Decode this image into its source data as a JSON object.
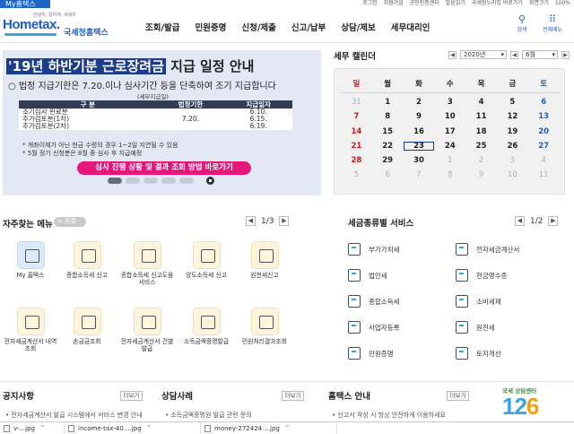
{
  "util": {
    "my_tab": "My홈택스",
    "links": [
      "로그인",
      "회원가입",
      "공인인증센터",
      "발음읽기",
      "국세청누리집 바로가기",
      "화면크기",
      "100%"
    ]
  },
  "header": {
    "logo_sub": "안녕히, 알차게, 세세히",
    "logo_home": "Hometax.",
    "logo_kor": "국세청홈택스",
    "nav": [
      "조회/발급",
      "민원증명",
      "신청/제출",
      "신고/납부",
      "상담/제보",
      "세무대리인"
    ],
    "search_label": "검색",
    "allmenu_label": "전체메뉴"
  },
  "banner": {
    "title_hl": "'19년 하반기분 근로장려금",
    "title_rest": " 지급 일정 안내",
    "line1": "○ 법정 지급기한은 7.20.이나 심사기간 등을 단축하여 조기 지급합니다",
    "note": "(세부지급일)",
    "table_headers": [
      "구   분",
      "법정기한",
      "지급일자"
    ],
    "table_rows": [
      [
        "조기심사 완료분",
        "",
        "6.10."
      ],
      [
        "추가검토분(1차)",
        "7.20.",
        "6.15."
      ],
      [
        "추가검토분(2차)",
        "",
        "6.19."
      ]
    ],
    "footnote1": "* 계좌이체가 아닌 현금 수령의 경우 1~2일 지연될 수 있음",
    "footnote2": "* 5월 정기 신청분은 8월 중 심사 후 지급예정",
    "cta": "심사 진행 상황 및 결과 조회 방법 바로가기"
  },
  "calendar": {
    "title": "세무 캘린더",
    "year": "2020년",
    "month": "6월",
    "weekdays": [
      "일",
      "월",
      "화",
      "수",
      "목",
      "금",
      "토"
    ],
    "weeks": [
      [
        "31",
        "1",
        "2",
        "3",
        "4",
        "5",
        "6"
      ],
      [
        "7",
        "8",
        "9",
        "10",
        "11",
        "12",
        "13"
      ],
      [
        "14",
        "15",
        "16",
        "17",
        "18",
        "19",
        "20"
      ],
      [
        "21",
        "22",
        "23",
        "24",
        "25",
        "26",
        "27"
      ],
      [
        "28",
        "29",
        "30",
        "1",
        "2",
        "3",
        "4"
      ],
      [
        "5",
        "6",
        "7",
        "8",
        "9",
        "10",
        "11"
      ]
    ],
    "today": "23"
  },
  "favorites": {
    "title": "자주찾는 메뉴",
    "add_label": "+ 등록",
    "page": "1/3",
    "items": [
      "My 홈택스",
      "종합소득세 신고",
      "종합소득세 신고도움 서비스",
      "양도소득세 신고",
      "원천세신고",
      "전자세금계산서 내역조회",
      "손금금조회",
      "전자세금계산서 건별발급",
      "소득금액증명발급",
      "민원처리결과조회"
    ]
  },
  "services": {
    "title": "세금종류별 서비스",
    "page": "1/2",
    "items": [
      "부가가치세",
      "전자세금계산서",
      "법인세",
      "현금영수증",
      "종합소득세",
      "소비세제",
      "사업자등록",
      "원천세",
      "민원증명",
      "토지개선"
    ]
  },
  "bottom": {
    "notice_title": "공지사항",
    "case_title": "상담사례",
    "hometax_title": "홈택스 안내",
    "more_label": "더보기",
    "notice_line": "• 전자세금계산서 발급 시스템에서 서비스 변경 안내",
    "case_line": "• 소득금액증명원 발급 관련 문의",
    "hometax_line": "• 신고서 작성 시 항상 안전하게 이용하세요",
    "promo_text": "국세 상담센터",
    "promo_num1": "12",
    "promo_num2": "6"
  },
  "downloads": [
    "v-...jpg",
    "income-tax-40....jpg",
    "money-272424....jpg"
  ]
}
